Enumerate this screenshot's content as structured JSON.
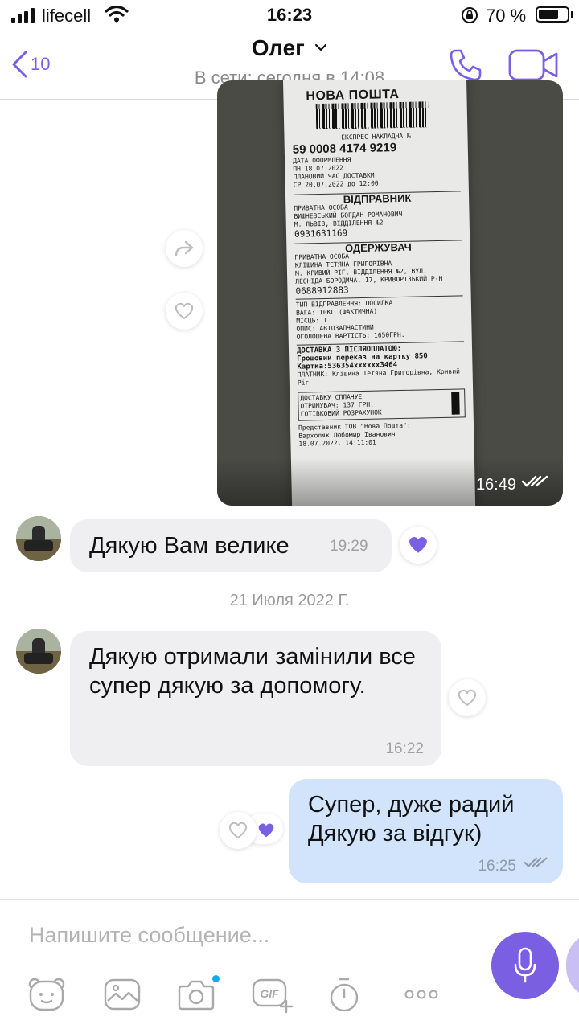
{
  "status_bar": {
    "carrier": "lifecell",
    "time": "16:23",
    "battery_percent": "70 %",
    "battery_level": 0.7
  },
  "header": {
    "back_count": "10",
    "contact_name": "Олег",
    "presence": "В сети: сегодня в 14:08"
  },
  "receipt": {
    "brand": "НОВА ПОШТА",
    "waybill_label": "ЕКСПРЕС-НАКЛАДНА №",
    "waybill_number": "59 0008 4174 9219",
    "lines_top": [
      "ДАТА ОФОРМЛЕННЯ",
      "ПН 18.07.2022",
      "ПЛАНОВИЙ ЧАС ДОСТАВКИ",
      "СР 20.07.2022 до 12:00"
    ],
    "sender_title": "ВІДПРАВНИК",
    "sender_lines": [
      "ПРИВАТНА ОСОБА",
      "ВИШНЕВСЬКИЙ БОГДАН РОМАНОВИЧ",
      "М. ЛЬВІВ, ВІДДІЛЕННЯ №2"
    ],
    "sender_phone": "0931631169",
    "recipient_title": "ОДЕРЖУВАЧ",
    "recipient_lines": [
      "ПРИВАТНА ОСОБА",
      "КЛІШИНА ТЕТЯНА ГРИГОРІВНА",
      "М. КРИВИЙ РІГ, ВІДДІЛЕННЯ №2, ВУЛ.",
      "ЛЕОНІДА БОРОДИЧА, 17, КРИВОРІЗЬКИЙ Р-Н"
    ],
    "recipient_phone": "0688912883",
    "cargo_lines": [
      "ТИП ВІДПРАВЛЕННЯ: ПОСИЛКА",
      "ВАГА: 10КГ (ФАКТИЧНА)",
      "МІСЦЬ: 1",
      "ОПИС: АВТОЗАПЧАСТИНИ",
      "ОГОЛОШЕНА ВАРТІСТЬ: 1650ГРН."
    ],
    "cod_lines": [
      "ДОСТАВКА З ПІСЛЯОПЛАТОЮ:",
      "Грошовий переказ на картку 850",
      "Картка:536354xxxxxx3464"
    ],
    "payer_lines": [
      "ПЛАТНИК: Клішина Тетяна Григорівна, Кривий",
      "Ріг"
    ],
    "paid_lines": [
      "ДОСТАВКУ СПЛАЧУЄ",
      "ОТРИМУВАЧ: 137 ГРН.",
      "ГОТІВКОВИЙ РОЗРАХУНОК"
    ],
    "footer_lines": [
      "Представник ТОВ \"Нова Пошта\":",
      "Вархоляк Любомир Іванович",
      "18.07.2022, 14:11:01"
    ]
  },
  "messages": [
    {
      "id": "photo",
      "direction": "out",
      "time": "16:49"
    },
    {
      "id": "thanks",
      "direction": "in",
      "text": "Дякую Вам велике",
      "time": "19:29"
    },
    {
      "id": "received",
      "direction": "in",
      "text": "Дякую отримали замінили все супер дякую за допомогу.",
      "time": "16:22"
    },
    {
      "id": "reply",
      "direction": "out",
      "text": "Супер, дуже радий Дякую за відгук)",
      "time": "16:25"
    }
  ],
  "date_separator": "21 Июля 2022 Г.",
  "composer": {
    "placeholder": "Напишите сообщение..."
  },
  "toolbar_icons": [
    "sticker-icon",
    "gallery-icon",
    "camera-icon",
    "gif-icon",
    "timer-icon",
    "more-icon"
  ],
  "colors": {
    "accent": "#7b5fe3",
    "incoming_bubble": "#efeff1",
    "outgoing_bubble": "#d2e4fb",
    "heart_liked": "#7b5fe3"
  }
}
